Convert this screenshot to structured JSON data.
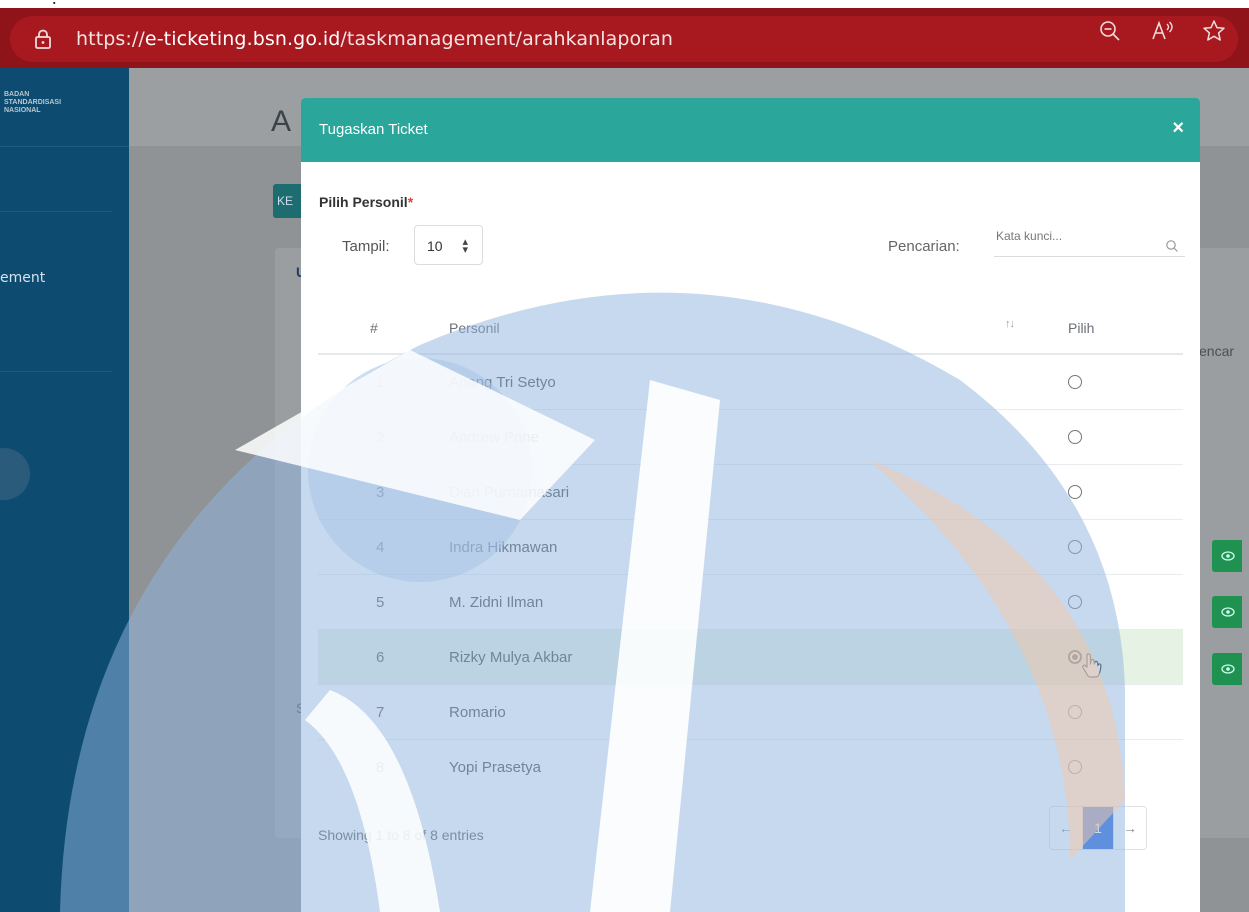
{
  "browser": {
    "url_prefix": "https://",
    "url_host": "e-ticketing.bsn.go.id",
    "url_path": "/taskmanagement/arahkanlaporan",
    "icons": [
      "lock-icon",
      "zoom-out-icon",
      "read-aloud-icon",
      "favorite-star-icon"
    ]
  },
  "background": {
    "logo_lines": [
      "BADAN",
      "STANDARDISASI",
      "NASIONAL"
    ],
    "sidebar_item": "ement",
    "page_title": "A",
    "button_label": "KE",
    "card_letter": "U",
    "card_footer_letter": "S",
    "search_fragment": "encar"
  },
  "modal": {
    "title": "Tugaskan Ticket",
    "close_label": "×",
    "section_label": "Pilih Personil",
    "required_mark": "*",
    "tampil_label": "Tampil:",
    "page_size": "10",
    "search_label": "Pencarian:",
    "search_placeholder": "Kata kunci...",
    "columns": {
      "num": "#",
      "name": "Personil",
      "sort": "↑↓",
      "pick": "Pilih"
    },
    "rows": [
      {
        "num": "1",
        "name": "Anang Tri Setyo",
        "selected": false
      },
      {
        "num": "2",
        "name": "Andrew Pane",
        "selected": false
      },
      {
        "num": "3",
        "name": "Dian Purnamasari",
        "selected": false
      },
      {
        "num": "4",
        "name": "Indra Hikmawan",
        "selected": false
      },
      {
        "num": "5",
        "name": "M. Zidni Ilman",
        "selected": false
      },
      {
        "num": "6",
        "name": "Rizky Mulya Akbar",
        "selected": true
      },
      {
        "num": "7",
        "name": "Romario",
        "selected": false
      },
      {
        "num": "8",
        "name": "Yopi Prasetya",
        "selected": false
      }
    ],
    "showing_text": "Showing 1 to 8 of 8 entries",
    "pager": {
      "prev": "←",
      "current": "1",
      "next": "→"
    }
  },
  "colors": {
    "browser_bar": "#8e1419",
    "modal_header": "#2aa69a",
    "selected_row": "#e6f2e4",
    "pager_active": "#2d6ddc",
    "sidebar": "#0d4c70"
  }
}
